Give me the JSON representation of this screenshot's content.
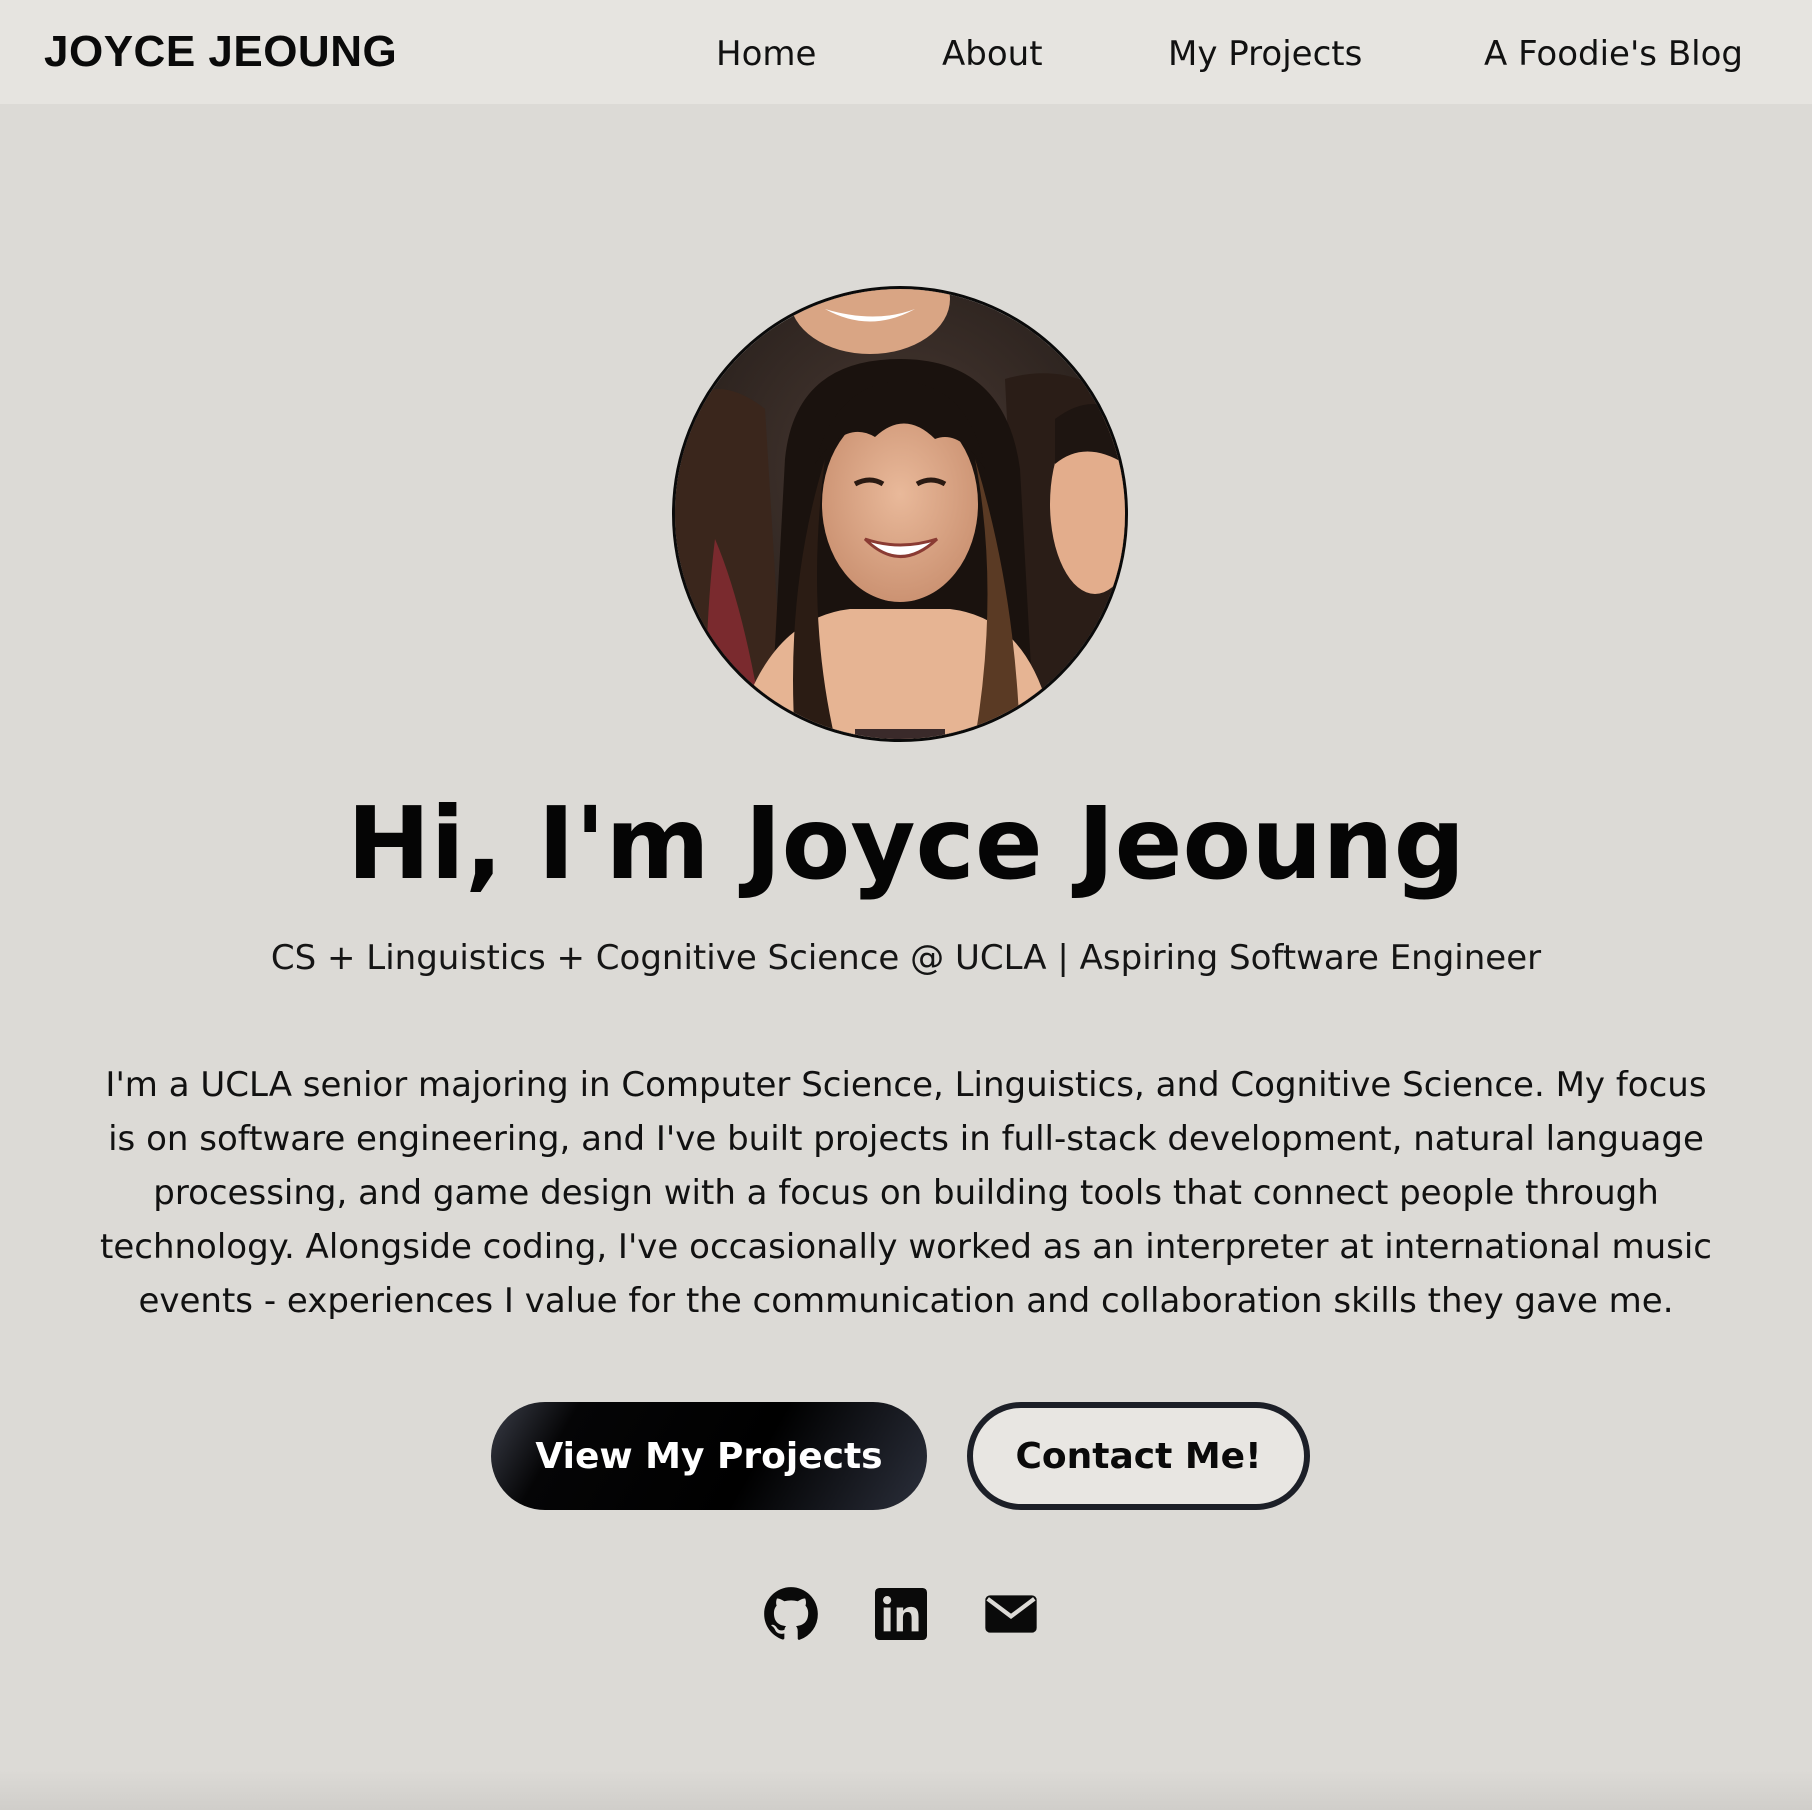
{
  "nav": {
    "brand": "JOYCE JEOUNG",
    "links": [
      {
        "label": "Home"
      },
      {
        "label": "About"
      },
      {
        "label": "My Projects"
      },
      {
        "label": "A Foodie's Blog"
      }
    ]
  },
  "hero": {
    "headline": "Hi, I'm Joyce Jeoung",
    "subtitle": "CS + Linguistics + Cognitive Science @ UCLA | Aspiring Software Engineer",
    "bio": "I'm a UCLA senior majoring in Computer Science, Linguistics, and Cognitive Science. My focus is on software engineering, and I've built projects in full-stack development, natural language processing, and game design with a focus on building tools that connect people through technology. Alongside coding, I've occasionally worked as an interpreter at international music events - experiences I value for the communication and collaboration skills they gave me.",
    "primary_button": "View My Projects",
    "secondary_button": "Contact Me!",
    "avatar_icon": "profile-photo"
  },
  "social": [
    {
      "icon": "github-icon"
    },
    {
      "icon": "linkedin-icon"
    },
    {
      "icon": "mail-icon"
    }
  ],
  "colors": {
    "background": "#dcdad6",
    "navbar": "#e6e4e0",
    "text": "#0a0a0a",
    "primary_button": "#050506",
    "secondary_border": "#1c1f27"
  }
}
